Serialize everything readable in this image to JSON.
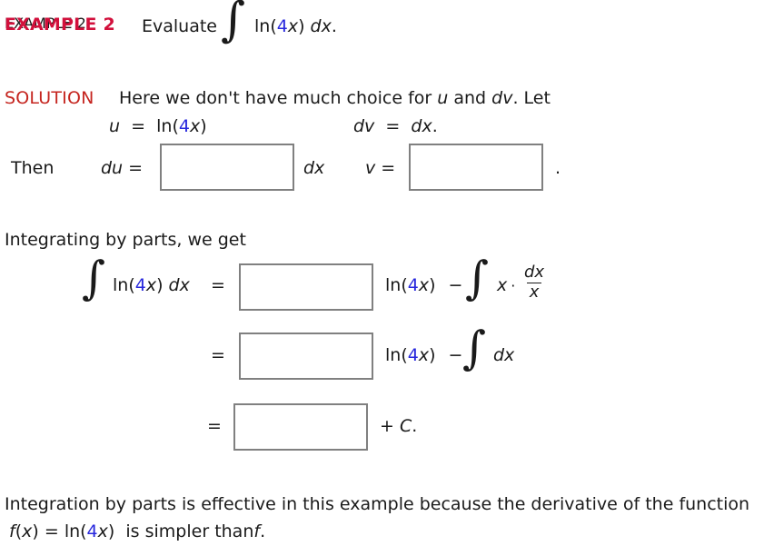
{
  "colors": {
    "example_label": "#d2103c",
    "solution_label": "#c5251f",
    "highlight_number": "#2727dd",
    "box_border": "#808080",
    "text": "#1a1a1a",
    "background": "#ffffff"
  },
  "header": {
    "example_label": "EXAMPLE 2",
    "instruction": "Evaluate",
    "integral_symbol": "∫",
    "integrand_ln": "ln(",
    "integrand_number": "4",
    "integrand_var": "x",
    "integrand_close": ")",
    "differential": "dx",
    "period": "."
  },
  "solution": {
    "label": "SOLUTION",
    "intro_text": "Here we don't have much choice for ",
    "intro_u": "u",
    "intro_and": " and ",
    "intro_dv": "dv",
    "intro_end": ". Let"
  },
  "assignments": {
    "u_symbol": "u",
    "equals": "=",
    "u_ln": "ln(",
    "u_number": "4",
    "u_var": "x",
    "u_close": ")",
    "dv_symbol": "dv",
    "dv_value": "dx",
    "dv_period": "."
  },
  "then_row": {
    "then_label": "Then",
    "du_symbol": "du",
    "equals": "=",
    "du_suffix": "dx",
    "v_symbol": "v",
    "v_equals": "=",
    "period": ".",
    "du_box": {
      "value": "",
      "placeholder": ""
    },
    "v_box": {
      "value": "",
      "placeholder": ""
    }
  },
  "integrating_text": "Integrating by parts, we get",
  "equation_lines": [
    {
      "name": "line-1",
      "lhs_integral": "∫",
      "lhs_ln": "ln(",
      "lhs_number": "4",
      "lhs_var": "x",
      "lhs_close": ")",
      "lhs_dx": "dx",
      "equals": "=",
      "box": {
        "value": "",
        "placeholder": ""
      },
      "rhs_ln": "ln(",
      "rhs_number": "4",
      "rhs_var": "x",
      "rhs_close": ")",
      "minus": "−",
      "rhs_integral": "∫",
      "rhs_x": "x",
      "rhs_dot": "·",
      "frac_numerator": "dx",
      "frac_denominator": "x"
    },
    {
      "name": "line-2",
      "equals": "=",
      "box": {
        "value": "",
        "placeholder": ""
      },
      "rhs_ln": "ln(",
      "rhs_number": "4",
      "rhs_var": "x",
      "rhs_close": ")",
      "minus": "−",
      "rhs_integral": "∫",
      "rhs_dx": "dx"
    },
    {
      "name": "line-3",
      "equals": "=",
      "box": {
        "value": "",
        "placeholder": ""
      },
      "plus": "+",
      "constant": "C",
      "period": "."
    }
  ],
  "footer": {
    "line1": "Integration by parts is effective in this example because the derivative of the function",
    "line2_f": "f",
    "line2_paren_open": "(",
    "line2_x": "x",
    "line2_paren_close": ")",
    "line2_equals": "=",
    "line2_ln": "ln(",
    "line2_number": "4",
    "line2_var": "x",
    "line2_close": ")",
    "line2_tail": "is simpler than ",
    "line2_f2": "f",
    "line2_period": "."
  }
}
